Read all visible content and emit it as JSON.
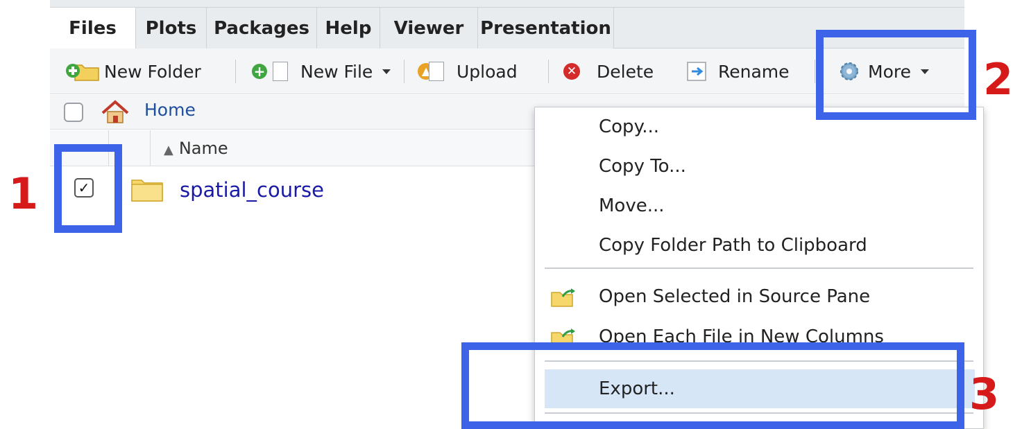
{
  "tabs": [
    {
      "label": "Files",
      "active": true
    },
    {
      "label": "Plots"
    },
    {
      "label": "Packages"
    },
    {
      "label": "Help"
    },
    {
      "label": "Viewer"
    },
    {
      "label": "Presentation"
    }
  ],
  "toolbar": {
    "new_folder": "New Folder",
    "new_file": "New File",
    "upload": "Upload",
    "delete": "Delete",
    "rename": "Rename",
    "more": "More"
  },
  "breadcrumb": {
    "home": "Home"
  },
  "columns": {
    "name": "Name",
    "sort_indicator": "▲"
  },
  "files": [
    {
      "name": "spatial_course",
      "checked": true,
      "type": "folder"
    }
  ],
  "menu": {
    "items": [
      {
        "label": "Copy..."
      },
      {
        "label": "Copy To..."
      },
      {
        "label": "Move..."
      },
      {
        "label": "Copy Folder Path to Clipboard"
      },
      {
        "label": "Open Selected in Source Pane",
        "icon": "folder-arrow-icon"
      },
      {
        "label": "Open Each File in New Columns",
        "icon": "folder-arrow-icon"
      },
      {
        "label": "Export...",
        "highlighted": true
      }
    ]
  },
  "annotations": {
    "one": "1",
    "two": "2",
    "three": "3"
  },
  "colors": {
    "annotation_box": "#3d63e8",
    "annotation_number": "#d61a1a",
    "link": "#1f4e9c",
    "menu_highlight": "#d6e6f7"
  }
}
